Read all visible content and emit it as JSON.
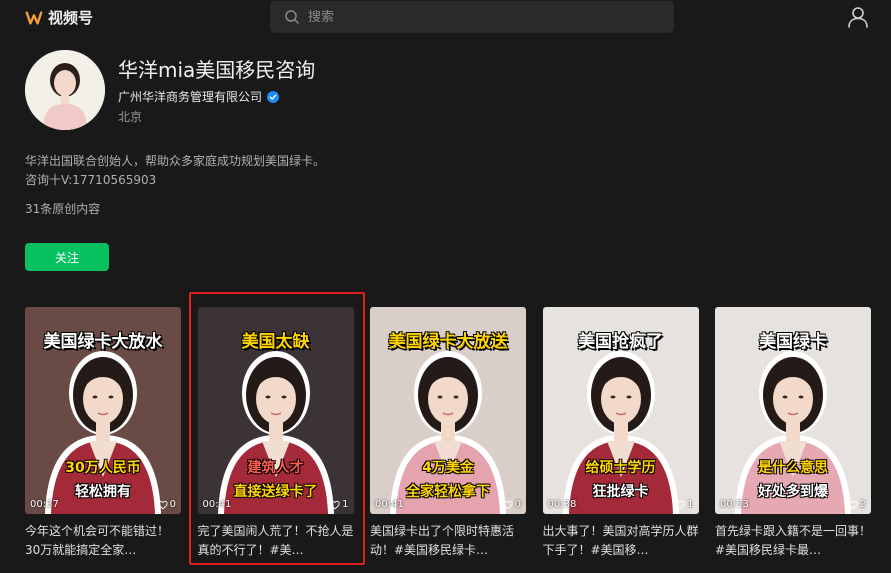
{
  "app": {
    "title": "视频号"
  },
  "search": {
    "placeholder": "搜索"
  },
  "profile": {
    "name": "华洋mia美国移民咨询",
    "company": "广州华洋商务管理有限公司",
    "location": "北京",
    "bio_line1": "华洋出国联合创始人，帮助众多家庭成功规划美国绿卡。",
    "bio_line2": "咨询十V:17710565903",
    "content_count": "31条原创内容",
    "follow_label": "关注"
  },
  "videos": [
    {
      "top": "美国绿卡大放水",
      "mid": "30万人民币",
      "bot": "轻松拥有",
      "duration": "00:37",
      "likes": "0",
      "caption": "今年这个机会可不能错过！30万就能搞定全家…",
      "bg": "#6a4a44",
      "jacket": "#a42a3a"
    },
    {
      "top": "美国太缺",
      "mid": "建筑人才",
      "bot": "直接送绿卡了",
      "duration": "00:41",
      "likes": "1",
      "caption": "完了美国闹人荒了！不抢人是真的不行了！#美…",
      "bg": "#3b3335",
      "jacket": "#a42a3a"
    },
    {
      "top": "美国绿卡大放送",
      "mid": "4万美金",
      "bot": "全家轻松拿下",
      "duration": "00:41",
      "likes": "0",
      "caption": "美国绿卡出了个限时特惠活动！#美国移民绿卡…",
      "bg": "#d9cfc8",
      "jacket": "#e4a3ad"
    },
    {
      "top": "美国抢疯了",
      "mid": "给硕士学历",
      "bot": "狂批绿卡",
      "duration": "00:38",
      "likes": "1",
      "caption": "出大事了！美国对高学历人群下手了！#美国移…",
      "bg": "#e6e2de",
      "jacket": "#a42a3a"
    },
    {
      "top": "美国绿卡",
      "mid": "是什么意思",
      "bot": "好处多到爆",
      "duration": "00:53",
      "likes": "2",
      "caption": "首先绿卡跟入籍不是一回事！#美国移民绿卡最…",
      "bg": "#e6e2de",
      "jacket": "#e6a8b2"
    }
  ],
  "colors": {
    "accent": "#07c160",
    "verified": "#1a8cff",
    "highlight": "#e0201c",
    "logo": "#fa9d3b"
  }
}
